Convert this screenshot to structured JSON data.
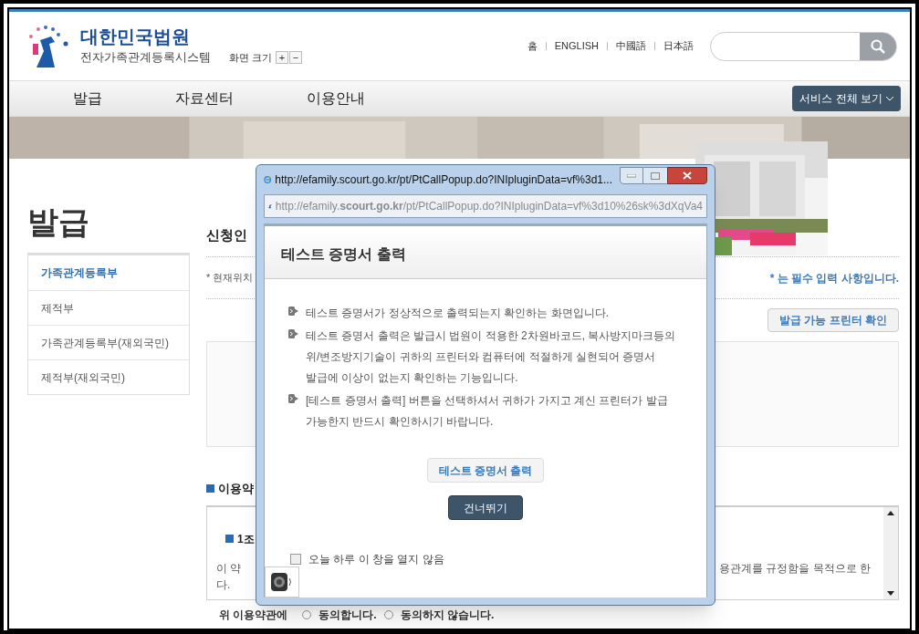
{
  "header": {
    "logo_title": "대한민국법원",
    "logo_subtitle": "전자가족관계등록시스템",
    "zoom_label": "화면 크기",
    "zoom_buttons": [
      "+",
      "−"
    ],
    "links": [
      "홈",
      "ENGLISH",
      "中國語",
      "日本語"
    ]
  },
  "nav": {
    "items": [
      "발급",
      "자료센터",
      "이용안내"
    ],
    "service_button": "서비스 전체 보기"
  },
  "sidebar": {
    "title": "발급",
    "items": [
      {
        "label": "가족관계등록부",
        "selected": true
      },
      {
        "label": "제적부",
        "selected": false
      },
      {
        "label": "가족관계등록부(재외국민)",
        "selected": false
      },
      {
        "label": "제적부(재외국민)",
        "selected": false
      }
    ]
  },
  "main": {
    "heading": "신청인",
    "location": "* 현재위치",
    "required_note": "* 는 필수 입력 사항입니다.",
    "printer_button": "발급 가능 프린터 확인",
    "terms_heading": "이용약",
    "terms_article": "1조",
    "terms_text_start": "이 약",
    "terms_text_end": "용관계를 규정함을 목적으로 한",
    "terms_text_wrap": "다.",
    "agree_label": "위 이용약관에",
    "agree_options": [
      {
        "label": "동의합니다.",
        "selected": false
      },
      {
        "label": "동의하지 않습니다.",
        "selected": false
      }
    ]
  },
  "popup": {
    "window_title": "http://efamily.scourt.go.kr/pt/PtCallPopup.do?INIpluginData=vf%3d1...",
    "address": "http://efamily.**scourt.go.kr**/pt/PtCallPopup.do?INIpluginData=vf%3d10%26sk%3dXqVa4",
    "heading": "테스트 증명서 출력",
    "bullets": [
      [
        "테스트 증명서가 정상적으로 출력되는지 확인하는 화면입니다."
      ],
      [
        "테스트 증명서 출력은 발급시 법원이 적용한 2차원바코드, 복사방지마크등의",
        "위/변조방지기술이 귀하의 프린터와 컴퓨터에 적절하게 실현되어 증명서",
        "발급에 이상이 없는지 확인하는 기능입니다."
      ],
      [
        "[테스트 증명서 출력] 버튼을 선택하셔서 귀하가 가지고 계신 프린터가 발급",
        "가능한지 반드시 확인하시기 바랍니다."
      ]
    ],
    "test_button": "테스트 증명서 출력",
    "skip_button": "건너뛰기",
    "dont_show": {
      "label": "오늘 하루 이 창을 열지 않음",
      "checked": false
    }
  }
}
